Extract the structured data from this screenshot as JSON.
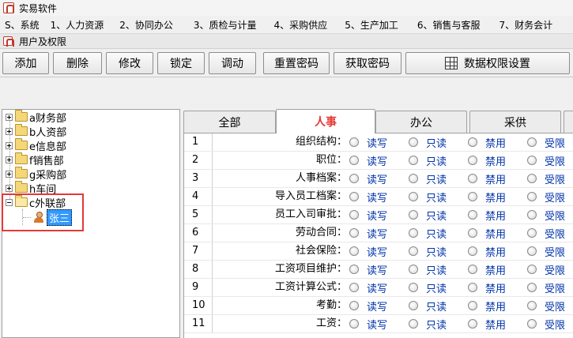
{
  "window": {
    "title": "实易软件"
  },
  "menu": [
    "S、系统",
    "1、人力资源",
    "2、协同办公",
    "3、质检与计量",
    "4、采购供应",
    "5、生产加工",
    "6、销售与客服",
    "7、财务会计"
  ],
  "subwindow": {
    "title": "用户及权限"
  },
  "toolbar": {
    "add": "添加",
    "delete": "删除",
    "modify": "修改",
    "lock": "锁定",
    "transfer": "调动",
    "reset_password": "重置密码",
    "get_password": "获取密码",
    "data_permission": "数据权限设置"
  },
  "tree": {
    "departments": [
      {
        "label": "a财务部",
        "expanded": false
      },
      {
        "label": "b人资部",
        "expanded": false
      },
      {
        "label": "e信息部",
        "expanded": false
      },
      {
        "label": "f销售部",
        "expanded": false
      },
      {
        "label": "g采购部",
        "expanded": false
      },
      {
        "label": "h车间",
        "expanded": false
      },
      {
        "label": "c外联部",
        "expanded": true
      }
    ],
    "user": "张三"
  },
  "tabs": [
    "全部",
    "人事",
    "办公",
    "采供"
  ],
  "active_tab": "人事",
  "options": [
    "读写",
    "只读",
    "禁用",
    "受限"
  ],
  "permissions": [
    {
      "num": "1",
      "label": "组织结构："
    },
    {
      "num": "2",
      "label": "职位："
    },
    {
      "num": "3",
      "label": "人事档案："
    },
    {
      "num": "4",
      "label": "导入员工档案："
    },
    {
      "num": "5",
      "label": "员工入司审批："
    },
    {
      "num": "6",
      "label": "劳动合同："
    },
    {
      "num": "7",
      "label": "社会保险："
    },
    {
      "num": "8",
      "label": "工资项目维护："
    },
    {
      "num": "9",
      "label": "工资计算公式："
    },
    {
      "num": "10",
      "label": "考勤："
    },
    {
      "num": "11",
      "label": "工资："
    }
  ],
  "colors": {
    "active_tab_text": "#e53935",
    "option_text": "#0033aa",
    "highlight": "#e53935"
  }
}
